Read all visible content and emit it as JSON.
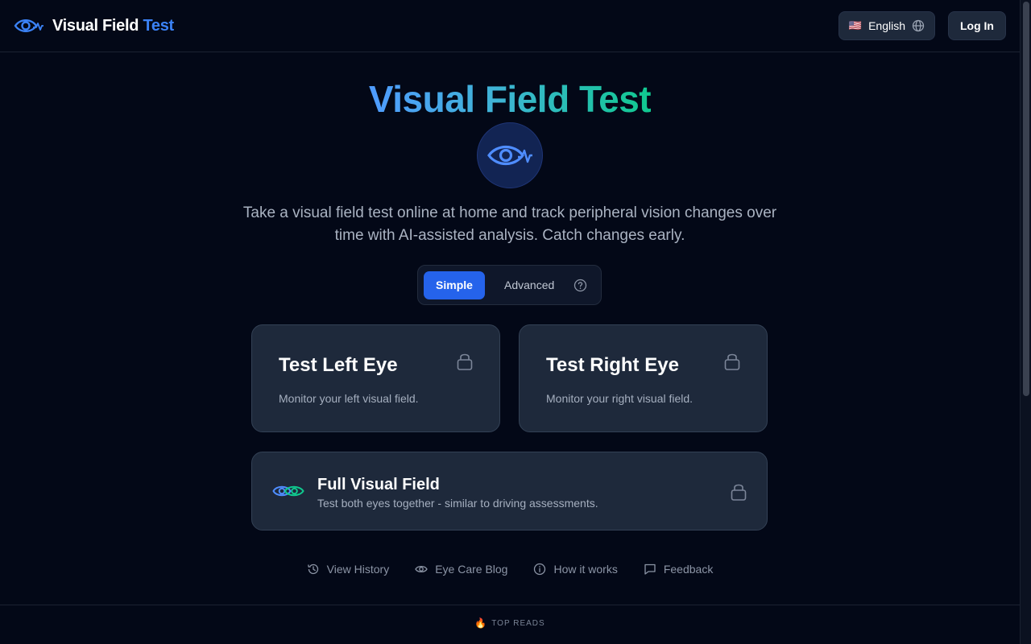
{
  "header": {
    "brand_main": "Visual Field",
    "brand_accent": "Test",
    "language": {
      "flag": "🇺🇸",
      "label": "English"
    },
    "login_label": "Log In"
  },
  "hero": {
    "title": "Visual Field Test",
    "subtitle": "Take a visual field test online at home and track peripheral vision changes over time with AI-assisted analysis. Catch changes early."
  },
  "mode_toggle": {
    "simple": "Simple",
    "advanced": "Advanced",
    "selected": "Simple"
  },
  "cards": {
    "left": {
      "title": "Test Left Eye",
      "description": "Monitor your left visual field."
    },
    "right": {
      "title": "Test Right Eye",
      "description": "Monitor your right visual field."
    },
    "full": {
      "title": "Full Visual Field",
      "description": "Test both eyes together - similar to driving assessments."
    }
  },
  "footer_links": [
    {
      "label": "View History",
      "icon": "history-icon"
    },
    {
      "label": "Eye Care Blog",
      "icon": "eye-icon"
    },
    {
      "label": "How it works",
      "icon": "info-icon"
    },
    {
      "label": "Feedback",
      "icon": "message-icon"
    }
  ],
  "top_reads": {
    "icon": "🔥",
    "label": "TOP READS"
  },
  "colors": {
    "background": "#030817",
    "card": "#1e293b",
    "accent_blue": "#2563eb",
    "gradient_start": "#4f9bff",
    "gradient_end": "#10c98f"
  }
}
